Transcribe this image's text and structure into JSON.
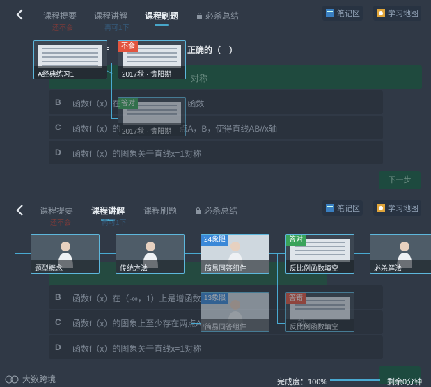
{
  "top": {
    "tabs": [
      "课程提要",
      "课程讲解",
      "课程刷题",
      "必杀总结"
    ],
    "active_tab": "课程刷题",
    "right_buttons": [
      "笔记区",
      "学习地图"
    ],
    "sub_labels": [
      "还不会",
      "再可1下"
    ],
    "question_fragment": "正确的（　）",
    "options": [
      {
        "key": "A",
        "text": "对称"
      },
      {
        "key": "B",
        "text": "函数f（x）在　　　　　　　　函数"
      },
      {
        "key": "C",
        "text": "函数f（x）的　　　　　　　点A，B，使得直线AB//x轴"
      },
      {
        "key": "D",
        "text": "函数f（x）的图象关于直线x=1对称"
      }
    ],
    "next_button": "下一步",
    "cards": [
      {
        "caption": "A经典练习1",
        "tag": ""
      },
      {
        "caption": "2017秋 · 贵阳期",
        "tag": "不会"
      },
      {
        "caption": "2017秋 · 贵阳期",
        "tag": "答对"
      }
    ]
  },
  "bottom": {
    "tabs": [
      "课程提要",
      "课程讲解",
      "课程刷题",
      "必杀总结"
    ],
    "active_tab": "课程讲解",
    "right_buttons": [
      "笔记区",
      "学习地图"
    ],
    "sub_labels": [
      "还不会",
      "再可1下"
    ],
    "options": [
      {
        "key": "B",
        "text": "函数f（x）在（-∞，1）上是增函数"
      },
      {
        "key": "C",
        "text": "函数f（x）的图象上至少存在两点A，　　　　　　　　　　　轴"
      },
      {
        "key": "D",
        "text": "函数f（x）的图象关于直线x=1对称"
      }
    ],
    "cards": [
      {
        "caption": "题型概念",
        "tag": ""
      },
      {
        "caption": "传统方法",
        "tag": ""
      },
      {
        "caption": "简易同答组件",
        "tag": "24象限"
      },
      {
        "caption": "反比例函数填空",
        "tag": "答对"
      },
      {
        "caption": "必杀解法",
        "tag": ""
      },
      {
        "caption": "简易同答组件",
        "tag": "13象限"
      },
      {
        "caption": "反比例函数填空",
        "tag": "答错"
      }
    ]
  },
  "status": {
    "brand": "大数跨境",
    "progress_label": "完成度：100%",
    "progress_value": 1.0,
    "remaining": "剩余0分钟"
  }
}
